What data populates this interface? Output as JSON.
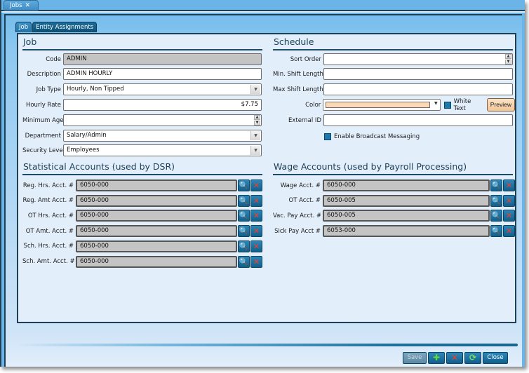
{
  "doc_tab": {
    "label": "Jobs",
    "close_glyph": "✕"
  },
  "inner_tabs": [
    {
      "label": "Job",
      "active": true
    },
    {
      "label": "Entity Assignments",
      "active": false
    }
  ],
  "job": {
    "title": "Job",
    "code": {
      "label": "Code",
      "value": "ADMIN"
    },
    "description": {
      "label": "Description",
      "value": "ADMIN HOURLY"
    },
    "job_type": {
      "label": "Job Type",
      "value": "Hourly, Non Tipped"
    },
    "hourly_rate": {
      "label": "Hourly Rate",
      "value": "$7.75"
    },
    "minimum_age": {
      "label": "Minimum Age",
      "value": ""
    },
    "department": {
      "label": "Department",
      "value": "Salary/Admin"
    },
    "security_level": {
      "label": "Security Level",
      "value": "Employees"
    }
  },
  "schedule": {
    "title": "Schedule",
    "sort_order": {
      "label": "Sort Order",
      "value": ""
    },
    "min_shift": {
      "label": "Min. Shift Length",
      "value": ""
    },
    "max_shift": {
      "label": "Max Shift Length",
      "value": ""
    },
    "color": {
      "label": "Color",
      "value": "#fad9b4"
    },
    "white_text": {
      "label": "White Text",
      "checked": false
    },
    "preview_label": "Preview",
    "external_id": {
      "label": "External ID",
      "value": ""
    },
    "broadcast": {
      "label": "Enable Broadcast Messaging",
      "checked": false
    }
  },
  "statistical": {
    "title": "Statistical Accounts (used by DSR)",
    "rows": [
      {
        "label": "Reg. Hrs. Acct. #",
        "value": "6050-000"
      },
      {
        "label": "Reg. Amt Acct. #",
        "value": "6050-000"
      },
      {
        "label": "OT Hrs. Acct. #",
        "value": "6050-000"
      },
      {
        "label": "OT Amt. Acct. #",
        "value": "6050-000"
      },
      {
        "label": "Sch. Hrs. Acct. #",
        "value": "6050-000"
      },
      {
        "label": "Sch. Amt. Acct. #",
        "value": "6050-000"
      }
    ]
  },
  "wage": {
    "title": "Wage Accounts (used by Payroll Processing)",
    "rows": [
      {
        "label": "Wage Acct. #",
        "value": "6050-000"
      },
      {
        "label": "OT Acct. #",
        "value": "6050-005"
      },
      {
        "label": "Vac. Pay Acct. #",
        "value": "6050-005"
      },
      {
        "label": "Sick Pay Acct #",
        "value": "6053-000"
      }
    ]
  },
  "icons": {
    "search": "🔍",
    "delete": "✕",
    "dropdown": "▼",
    "spin_up": "▲",
    "spin_down": "▼",
    "add": "✚",
    "refresh": "⟳"
  },
  "toolbar": {
    "save_label": "Save",
    "close_label": "Close"
  }
}
